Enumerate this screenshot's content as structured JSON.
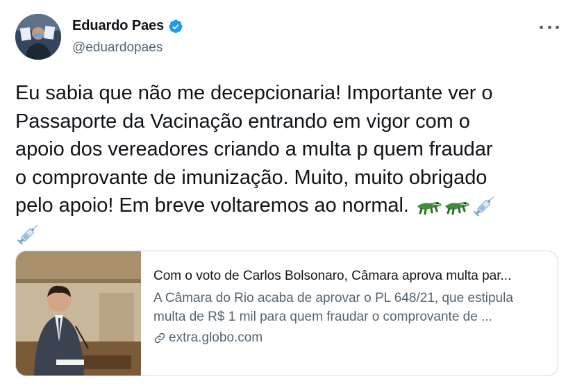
{
  "author": {
    "display_name": "Eduardo Paes",
    "handle": "@eduardopaes",
    "verified_icon": "verified-badge-icon",
    "verified_color": "#1d9bf0"
  },
  "tweet": {
    "lines": [
      "Eu sabia que não me decepcionaria! Importante ver o",
      "Passaporte da Vacinação entrando em vigor com o",
      "apoio dos vereadores criando a  multa p quem fraudar",
      "o comprovante de imunização.  Muito, muito obrigado",
      "pelo apoio! Em breve voltaremos ao normal."
    ],
    "emojis": [
      "crocodile-icon",
      "crocodile-icon",
      "syringe-icon",
      "syringe-icon"
    ]
  },
  "card": {
    "title": "Com o voto de Carlos Bolsonaro, Câmara aprova multa par...",
    "description_line1": "A Câmara do Rio acaba de aprovar o PL 648/21, que estipula",
    "description_line2": "multa de R$ 1 mil para quem fraudar o comprovante de ...",
    "domain": "extra.globo.com",
    "link_icon": "link-icon"
  },
  "colors": {
    "text": "#0f1419",
    "secondary": "#536471",
    "border": "#cfd9de",
    "verified": "#1d9bf0"
  }
}
